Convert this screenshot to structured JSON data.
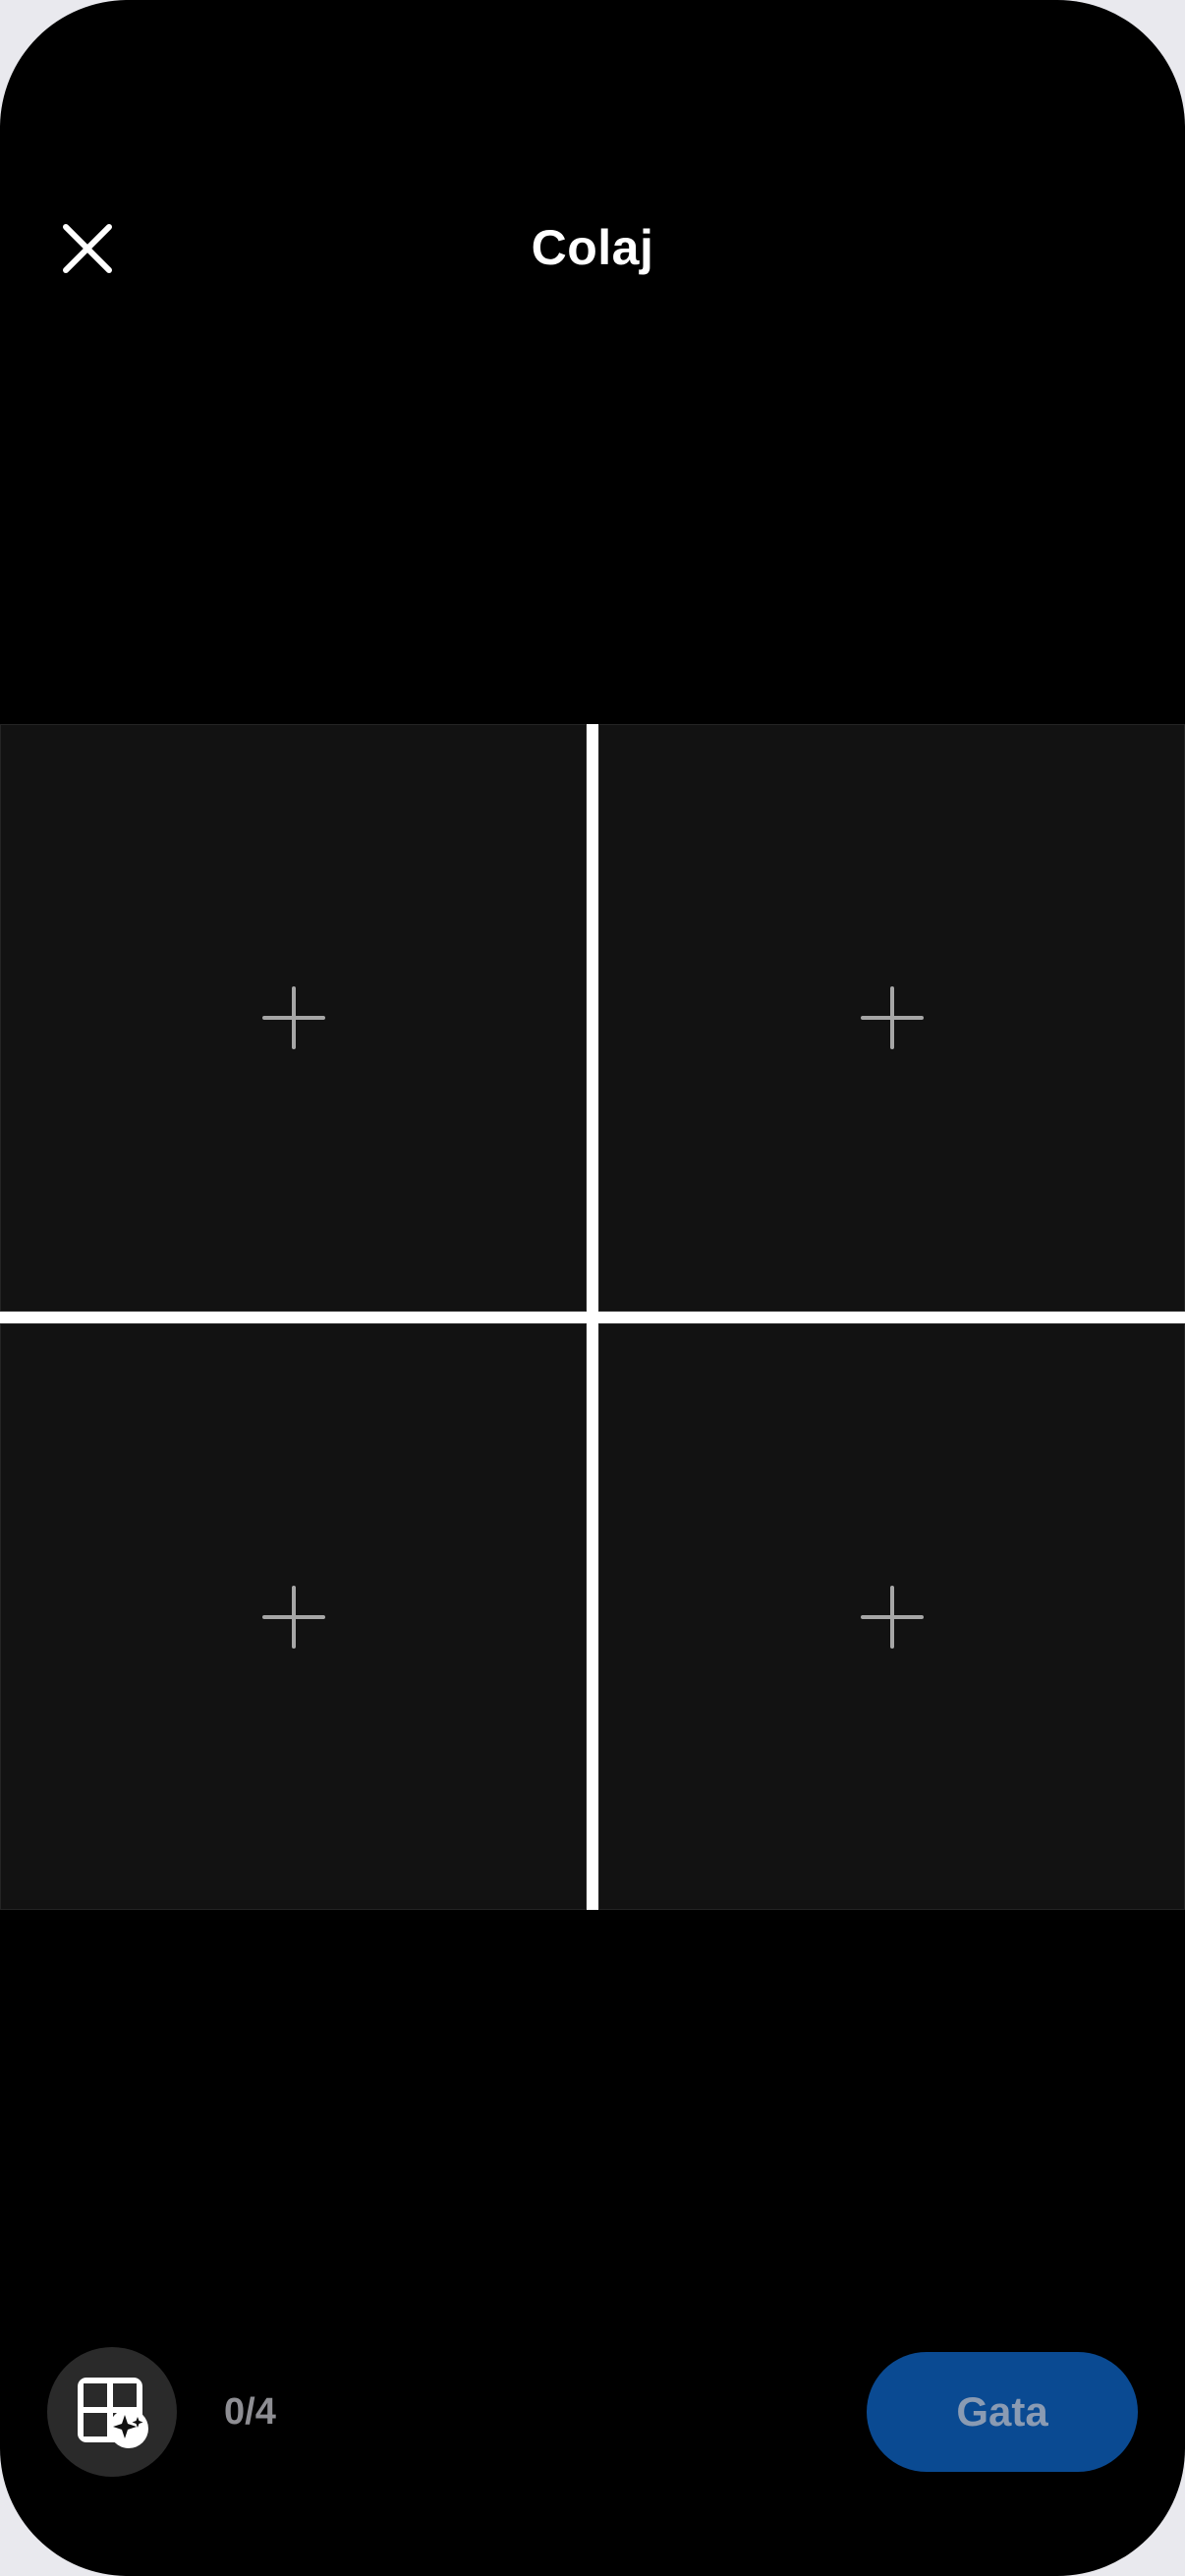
{
  "header": {
    "title": "Colaj",
    "close_icon": "close-icon"
  },
  "collage": {
    "slots": [
      {
        "icon": "plus-icon"
      },
      {
        "icon": "plus-icon"
      },
      {
        "icon": "plus-icon"
      },
      {
        "icon": "plus-icon"
      }
    ],
    "divider_color": "#ffffff",
    "slot_color": "#121212"
  },
  "footer": {
    "layout_icon": "grid-sparkle-icon",
    "counter": "0/4",
    "next_label": "Gata",
    "next_color": "#0a4a92"
  }
}
